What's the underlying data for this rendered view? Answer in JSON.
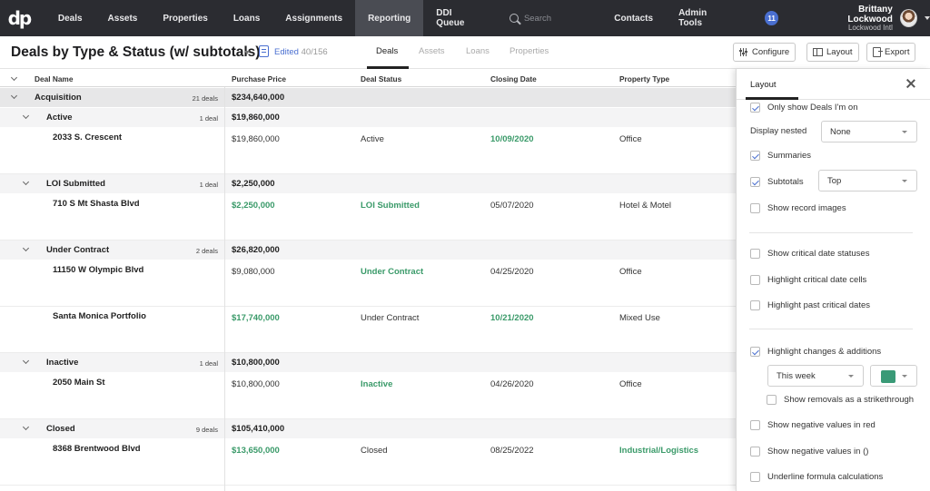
{
  "app": {
    "logo": "dp"
  },
  "nav": {
    "items": [
      "Deals",
      "Assets",
      "Properties",
      "Loans",
      "Assignments",
      "Reporting",
      "DDI Queue"
    ],
    "active": "Reporting",
    "search_placeholder": "Search",
    "right_items": [
      "Contacts",
      "Admin Tools"
    ],
    "notifications": "11",
    "user_name": "Brittany Lockwood",
    "user_org": "Lockwood Intl"
  },
  "titlebar": {
    "title": "Deals by Type & Status (w/ subtotals)",
    "edited_label": "Edited",
    "edited_count": "40/156",
    "tabs": [
      "Deals",
      "Assets",
      "Loans",
      "Properties"
    ],
    "active_tab": "Deals",
    "configure_label": "Configure",
    "layout_label": "Layout",
    "export_label": "Export"
  },
  "grid": {
    "columns": [
      "Deal Name",
      "Purchase Price",
      "Deal Status",
      "Closing Date",
      "Property Type"
    ],
    "rows": [
      {
        "kind": "group1",
        "name": "Acquisition",
        "count": "21 deals",
        "amount": "$234,640,000"
      },
      {
        "kind": "group2",
        "name": "Active",
        "count": "1 deal",
        "amount": "$19,860,000"
      },
      {
        "kind": "deal",
        "name": "2033 S. Crescent",
        "price": "$19,860,000",
        "price_green": false,
        "status": "Active",
        "status_green": false,
        "date": "10/09/2020",
        "date_green": true,
        "ptype": "Office",
        "ptype_green": false
      },
      {
        "kind": "group2",
        "name": "LOI Submitted",
        "count": "1 deal",
        "amount": "$2,250,000"
      },
      {
        "kind": "deal",
        "name": "710 S Mt Shasta Blvd",
        "price": "$2,250,000",
        "price_green": true,
        "status": "LOI Submitted",
        "status_green": true,
        "date": "05/07/2020",
        "date_green": false,
        "ptype": "Hotel & Motel",
        "ptype_green": false
      },
      {
        "kind": "group2",
        "name": "Under Contract",
        "count": "2 deals",
        "amount": "$26,820,000"
      },
      {
        "kind": "deal",
        "name": "11150 W Olympic Blvd",
        "price": "$9,080,000",
        "price_green": false,
        "status": "Under Contract",
        "status_green": true,
        "date": "04/25/2020",
        "date_green": false,
        "ptype": "Office",
        "ptype_green": false
      },
      {
        "kind": "deal",
        "name": "Santa Monica Portfolio",
        "price": "$17,740,000",
        "price_green": true,
        "status": "Under Contract",
        "status_green": false,
        "date": "10/21/2020",
        "date_green": true,
        "ptype": "Mixed Use",
        "ptype_green": false
      },
      {
        "kind": "group2",
        "name": "Inactive",
        "count": "1 deal",
        "amount": "$10,800,000"
      },
      {
        "kind": "deal",
        "name": "2050 Main St",
        "price": "$10,800,000",
        "price_green": false,
        "status": "Inactive",
        "status_green": true,
        "date": "04/26/2020",
        "date_green": false,
        "ptype": "Office",
        "ptype_green": false
      },
      {
        "kind": "group2",
        "name": "Closed",
        "count": "9 deals",
        "amount": "$105,410,000"
      },
      {
        "kind": "deal",
        "name": "8368 Brentwood Blvd",
        "price": "$13,650,000",
        "price_green": true,
        "status": "Closed",
        "status_green": false,
        "date": "08/25/2022",
        "date_green": false,
        "ptype": "Industrial/Logistics",
        "ptype_green": true
      }
    ]
  },
  "panel": {
    "title": "Layout",
    "only_mine": "Only show Deals I'm on",
    "display_nested_label": "Display nested",
    "display_nested_value": "None",
    "summaries": "Summaries",
    "subtotals": "Subtotals",
    "subtotals_value": "Top",
    "show_record_images": "Show record images",
    "show_critical": "Show critical date statuses",
    "highlight_critical": "Highlight critical date cells",
    "highlight_past": "Highlight past critical dates",
    "highlight_changes": "Highlight changes & additions",
    "period_value": "This week",
    "strikethrough": "Show removals as a strikethrough",
    "neg_red": "Show negative values in red",
    "neg_paren": "Show negative values in ()",
    "underline_formula": "Underline formula calculations"
  },
  "colors": {
    "accent": "#4a6fd0",
    "green": "#3a9a69",
    "nav_bg": "#2b2c31",
    "highlight_swatch": "#3a9a77"
  }
}
